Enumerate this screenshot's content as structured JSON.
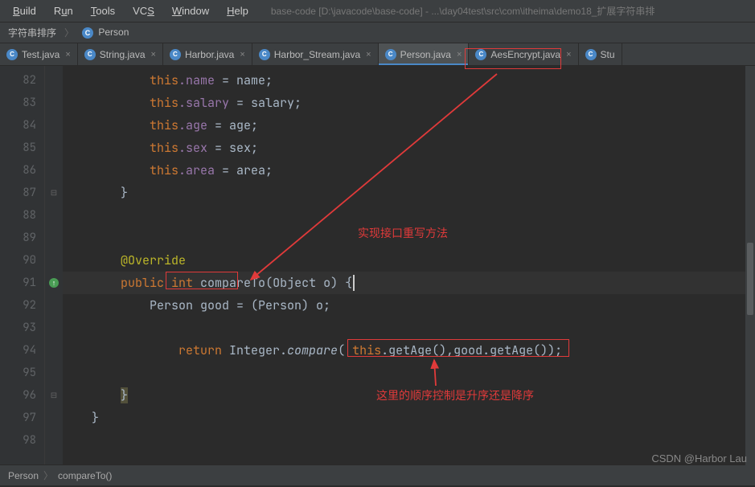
{
  "menu": {
    "build": "Build",
    "run": "Run",
    "tools": "Tools",
    "vcs": "VCS",
    "window": "Window",
    "help": "Help"
  },
  "title_path": "base-code [D:\\javacode\\base-code] - ...\\day04test\\src\\com\\itheima\\demo18_扩展字符串排",
  "breadcrumb": {
    "item1": "字符串排序",
    "item2": "Person"
  },
  "tabs": [
    {
      "label": "Test.java"
    },
    {
      "label": "String.java"
    },
    {
      "label": "Harbor.java"
    },
    {
      "label": "Harbor_Stream.java"
    },
    {
      "label": "Person.java",
      "active": true
    },
    {
      "label": "AesEncrypt.java"
    },
    {
      "label": "Stu"
    }
  ],
  "line_numbers": [
    "82",
    "83",
    "84",
    "85",
    "86",
    "87",
    "88",
    "89",
    "90",
    "91",
    "92",
    "93",
    "94",
    "95",
    "96",
    "97",
    "98"
  ],
  "code": {
    "l82_this": "this",
    "l82_name": ".name",
    "l82_rest": " = name;",
    "l83_this": "this",
    "l83_salary": ".salary",
    "l83_rest": " = salary;",
    "l84_this": "this",
    "l84_age": ".age",
    "l84_rest": " = age;",
    "l85_this": "this",
    "l85_sex": ".sex",
    "l85_rest": " = sex;",
    "l86_this": "this",
    "l86_area": ".area",
    "l86_rest": " = area;",
    "l87": "        }",
    "l90_ann": "@Override",
    "l91_pub": "public ",
    "l91_int": "int ",
    "l91_name": "compareTo",
    "l91_sig": "(Object o) {",
    "l92_pre": "            Person good = (Person) o;",
    "l94_ret": "return ",
    "l94_intg": "Integer.",
    "l94_cmp": "compare",
    "l94_open": "( ",
    "l94_this": "this",
    "l94_rest": ".getAge(),good.getAge());",
    "l96": "        }",
    "l97": "    }"
  },
  "annotations": {
    "a1": "实现接口重写方法",
    "a2": "这里的顺序控制是升序还是降序"
  },
  "status": {
    "s1": "Person",
    "s2": "compareTo()"
  },
  "watermark": "CSDN @Harbor Lau"
}
